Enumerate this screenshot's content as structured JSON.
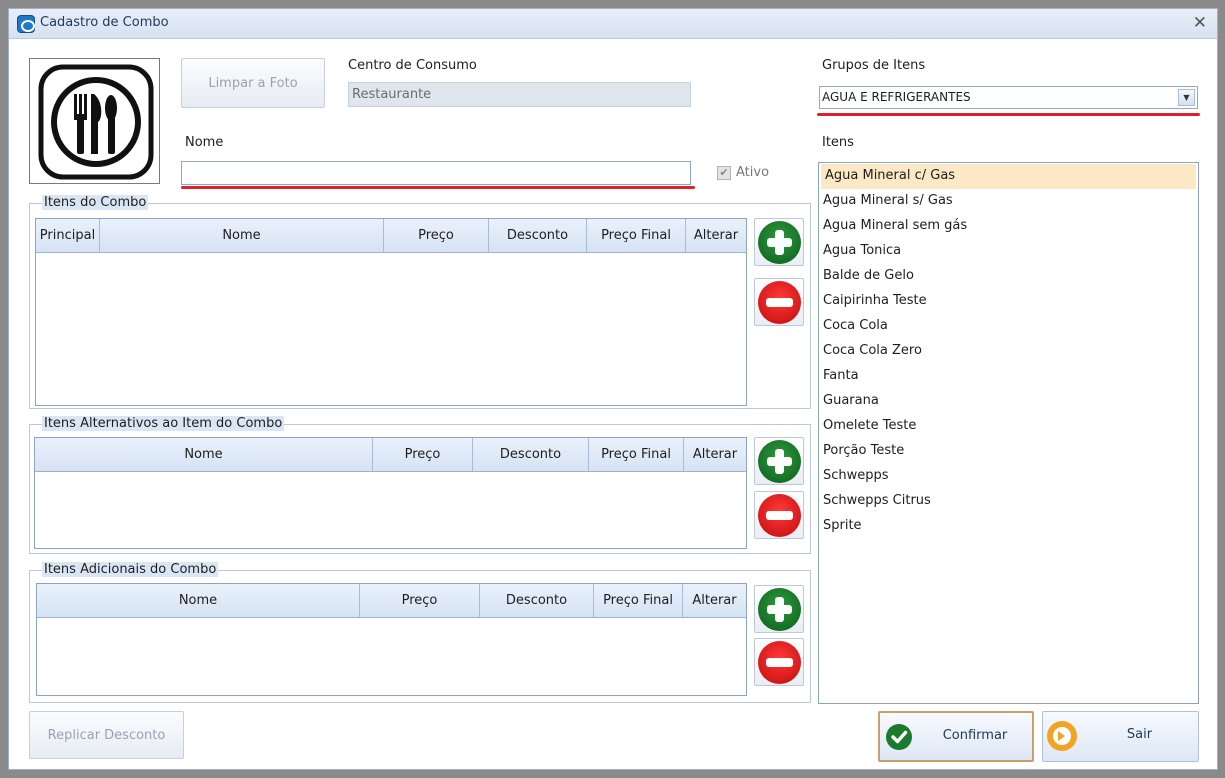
{
  "window": {
    "title": "Cadastro de Combo"
  },
  "photo": {
    "clear_button_label": "Limpar a Foto"
  },
  "centro_consumo": {
    "label": "Centro de Consumo",
    "value": "Restaurante"
  },
  "nome": {
    "label": "Nome",
    "value": ""
  },
  "ativo": {
    "label": "Ativo",
    "checked": true
  },
  "itens_combo": {
    "title": "Itens do Combo",
    "columns": [
      "Principal",
      "Nome",
      "Preço",
      "Desconto",
      "Preço Final",
      "Alterar"
    ]
  },
  "itens_alternativos": {
    "title": "Itens Alternativos ao Item do Combo",
    "columns": [
      "Nome",
      "Preço",
      "Desconto",
      "Preço Final",
      "Alterar"
    ]
  },
  "itens_adicionais": {
    "title": "Itens Adicionais do Combo",
    "columns": [
      "Nome",
      "Preço",
      "Desconto",
      "Preço Final",
      "Alterar"
    ]
  },
  "grupos": {
    "label": "Grupos de Itens",
    "selected": "AGUA E REFRIGERANTES"
  },
  "itens": {
    "label": "Itens",
    "items": [
      "Agua Mineral c/ Gas",
      "Agua Mineral s/ Gas",
      "Agua Mineral sem gás",
      "Agua Tonica",
      "Balde de Gelo",
      "Caipirinha Teste",
      "Coca Cola",
      "Coca Cola Zero",
      "Fanta",
      "Guarana",
      "Omelete Teste",
      "Porção Teste",
      "Schwepps",
      "Schwepps Citrus",
      "Sprite"
    ]
  },
  "footer": {
    "replicar_label": "Replicar Desconto",
    "confirmar_label": "Confirmar",
    "sair_label": "Sair"
  },
  "colors": {
    "accent_red": "#d9222a",
    "add_green": "#1b7a2b",
    "remove_red": "#e01010",
    "selection": "#fbe8c4"
  }
}
